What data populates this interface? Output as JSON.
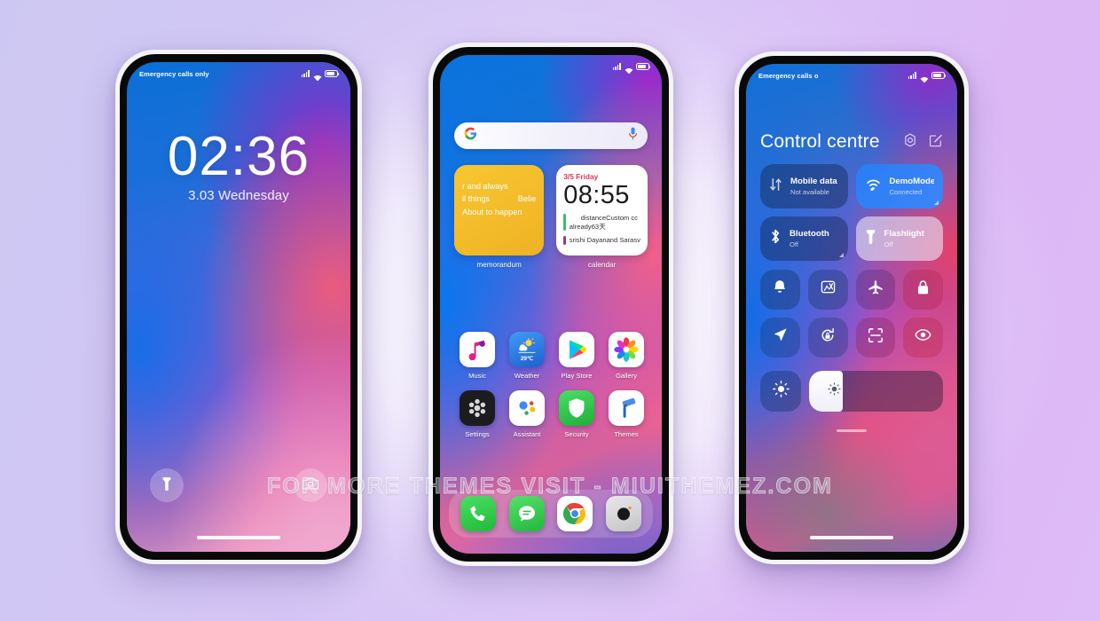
{
  "watermark": "FOR MORE THEMES VISIT - MIUITHEMEZ.COM",
  "colors": {
    "page_bg_left": "#cdc8f3",
    "page_bg_right": "#dcb8f5",
    "accent_blue": "#2a7df5",
    "memo_yellow": "#f3bb2a",
    "calendar_red": "#e8345a",
    "security_green": "#37c24a"
  },
  "lockscreen": {
    "status": {
      "carrier": "Emergency calls only",
      "signal_icon": "signal-bars-icon",
      "wifi_icon": "wifi-icon",
      "battery_icon": "battery-icon"
    },
    "clock": "02:36",
    "date": "3.03 Wednesday",
    "shortcuts": [
      {
        "name": "flashlight",
        "icon": "flashlight-icon"
      },
      {
        "name": "camera",
        "icon": "camera-icon"
      }
    ],
    "home_indicator": "home-bar"
  },
  "homescreen": {
    "status": {
      "carrier": "",
      "signal_icon": "signal-bars-icon",
      "wifi_icon": "wifi-icon",
      "battery_icon": "battery-icon"
    },
    "search": {
      "placeholder": "",
      "value": "",
      "left_icon": "google-g-icon",
      "right_icon": "microphone-icon"
    },
    "widgets": [
      {
        "label": "memorandum",
        "type": "notes",
        "lines": [
          "r and always",
          "il things",
          "Belie",
          "About to happen"
        ]
      },
      {
        "label": "calendar",
        "type": "calendar",
        "date": "3/5 Friday",
        "time": "08:55",
        "events": [
          {
            "color": "#3ebb6a",
            "line1": "distanceCustom cc",
            "line2": "already63天"
          },
          {
            "color": "#8c3f8f",
            "line1": "srishi Dayanand Sarasv",
            "line2": ""
          }
        ]
      }
    ],
    "apps": [
      {
        "label": "Music",
        "icon": "music-note-icon"
      },
      {
        "label": "Weather",
        "icon": "weather-sun-cloud-icon",
        "badge": "29℃"
      },
      {
        "label": "Play Store",
        "icon": "play-store-icon"
      },
      {
        "label": "Gallery",
        "icon": "gallery-flower-icon"
      },
      {
        "label": "Settings",
        "icon": "settings-gear-icon"
      },
      {
        "label": "Assistant",
        "icon": "google-assistant-icon"
      },
      {
        "label": "Security",
        "icon": "shield-icon"
      },
      {
        "label": "Themes",
        "icon": "paint-roller-icon"
      }
    ],
    "dock": [
      {
        "label": "Phone",
        "icon": "phone-handset-icon"
      },
      {
        "label": "Messages",
        "icon": "message-bubble-icon"
      },
      {
        "label": "Chrome",
        "icon": "chrome-icon"
      },
      {
        "label": "Camera",
        "icon": "camera-lens-icon"
      }
    ]
  },
  "controlcentre": {
    "status": {
      "carrier": "Emergency calls o",
      "signal_icon": "signal-bars-icon",
      "wifi_icon": "wifi-icon",
      "battery_icon": "battery-icon"
    },
    "title": "Control centre",
    "header_icons": [
      {
        "name": "settings-gear-icon"
      },
      {
        "name": "edit-pencil-icon"
      }
    ],
    "big_tiles": [
      {
        "title": "Mobile data",
        "subtitle": "Not available",
        "icon": "data-arrows-icon",
        "state": "off",
        "expandable": false
      },
      {
        "title": "DemoMode",
        "subtitle": "Connected",
        "icon": "wifi-icon",
        "state": "on",
        "expandable": true
      },
      {
        "title": "Bluetooth",
        "subtitle": "Off",
        "icon": "bluetooth-icon",
        "state": "off",
        "expandable": true
      },
      {
        "title": "Flashlight",
        "subtitle": "Off",
        "icon": "flashlight-icon",
        "state": "light",
        "expandable": false
      }
    ],
    "small_tiles": [
      {
        "name": "silent-bell-icon",
        "label": "Silent"
      },
      {
        "name": "screenshot-icon",
        "label": "Screenshot"
      },
      {
        "name": "airplane-icon",
        "label": "Airplane mode"
      },
      {
        "name": "lock-icon",
        "label": "Lock"
      },
      {
        "name": "location-icon",
        "label": "Location"
      },
      {
        "name": "rotation-lock-icon",
        "label": "Auto-rotate"
      },
      {
        "name": "scan-icon",
        "label": "Scanner"
      },
      {
        "name": "eye-icon",
        "label": "Reading mode"
      }
    ],
    "brightness": {
      "icon": "brightness-sun-icon",
      "value_percent": 25
    },
    "drag_handle": "drag-handle"
  }
}
